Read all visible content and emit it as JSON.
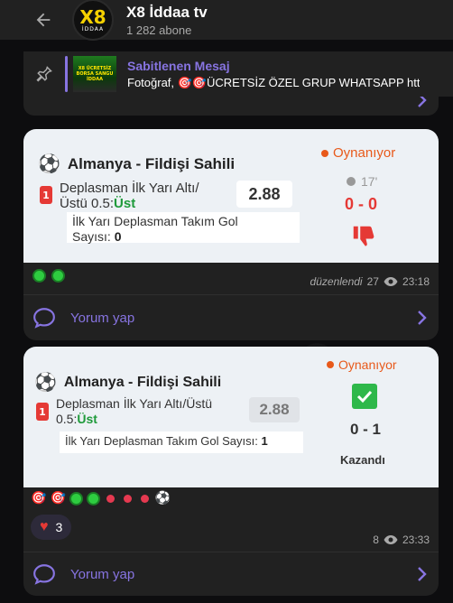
{
  "channel": {
    "title": "X8 İddaa tv",
    "subscribers": "1 282 abone",
    "logo_main": "X8",
    "logo_sub": "İDDAA"
  },
  "pinned": {
    "title": "Sabitlenen Mesaj",
    "body": "Fotoğraf, 🎯🎯ÜCRETSİZ ÖZEL GRUP WHATSAPP htt",
    "thumb_text": "X8 ÜCRETSİZ BORSA SANGU İDDAA"
  },
  "comment_label": "Yorum yap",
  "messages": [
    {
      "match": "Almanya - Fildişi Sahili",
      "status": "Oynanıyor",
      "number": "1",
      "bet_line1": "Deplasman İlk Yarı Altı/",
      "bet_line2": "Üstü 0.5:",
      "pick": "Üst",
      "odds": "2.88",
      "info_label": "İlk Yarı Deplasman Takım Gol",
      "info_label2": "Sayısı:",
      "info_value": "0",
      "minute": "17'",
      "score": "0 - 0",
      "edited": "düzenlendi",
      "views": "27",
      "time": "23:18"
    },
    {
      "match": "Almanya - Fildişi Sahili",
      "status": "Oynanıyor",
      "number": "1",
      "bet_line1": "Deplasman İlk Yarı Altı/Üstü",
      "bet_line2": "0.5:",
      "pick": "Üst",
      "odds": "2.88",
      "info_label": "İlk Yarı Deplasman Takım Gol Sayısı:",
      "info_value": "1",
      "score": "0 - 1",
      "result": "Kazandı",
      "reaction_count": "3",
      "views": "8",
      "time": "23:33"
    }
  ],
  "colors": {
    "accent": "#8774e1",
    "live": "#e8591a",
    "lose": "#e53935",
    "win": "#1e9a3a"
  }
}
